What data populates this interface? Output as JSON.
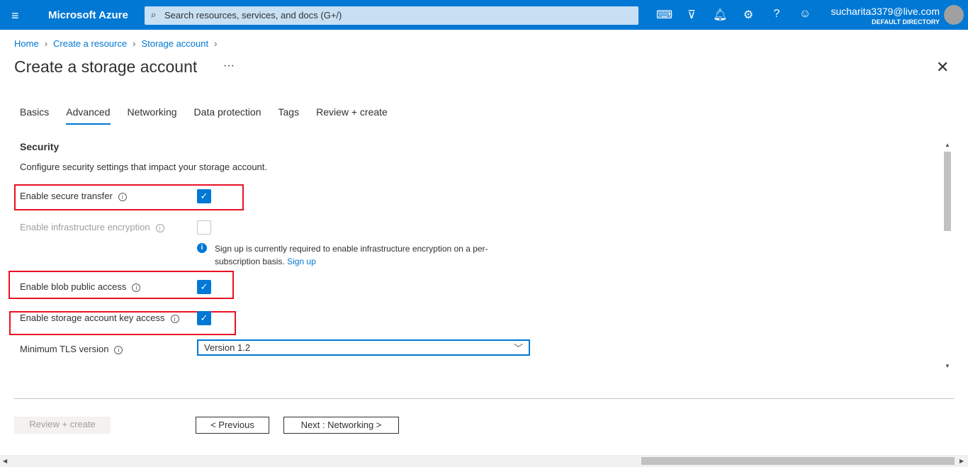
{
  "topbar": {
    "brand": "Microsoft Azure",
    "search_placeholder": "Search resources, services, and docs (G+/)",
    "user": "sucharita3379@live.com",
    "directory": "DEFAULT DIRECTORY"
  },
  "breadcrumb": [
    "Home",
    "Create a resource",
    "Storage account"
  ],
  "title": "Create a storage account",
  "more": "···",
  "tabs": [
    "Basics",
    "Advanced",
    "Networking",
    "Data protection",
    "Tags",
    "Review + create"
  ],
  "section": {
    "title": "Security",
    "description": "Configure security settings that impact your storage account."
  },
  "fields": {
    "secure_transfer": {
      "label": "Enable secure transfer",
      "checked": true
    },
    "infra_encryption": {
      "label": "Enable infrastructure encryption",
      "checked": false,
      "disabled": true
    },
    "note": "Sign up is currently required to enable infrastructure encryption on a per-subscription basis.",
    "note_link": "Sign up",
    "blob_public": {
      "label": "Enable blob public access",
      "checked": true
    },
    "key_access": {
      "label": "Enable storage account key access",
      "checked": true
    },
    "tls": {
      "label": "Minimum TLS version",
      "value": "Version 1.2"
    }
  },
  "footer": {
    "review": "Review + create",
    "previous": "< Previous",
    "next": "Next : Networking >"
  }
}
